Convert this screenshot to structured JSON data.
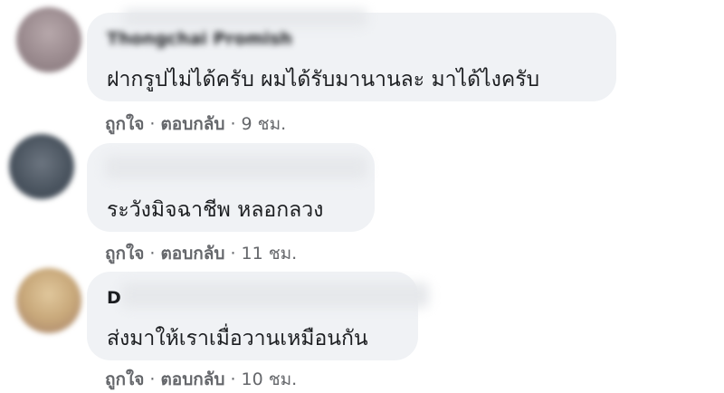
{
  "comments": [
    {
      "name": "Thongchai Promish",
      "text": "ฝากรูปไม่ได้ครับ ผมได้รับมานานละ มาได้ไงครับ",
      "like": "ถูกใจ",
      "reply": "ตอบกลับ",
      "time": "9 ชม.",
      "avatar_color": "#9a8a8e"
    },
    {
      "name": "",
      "text": "ระวังมิจฉาชีพ หลอกลวง",
      "like": "ถูกใจ",
      "reply": "ตอบกลับ",
      "time": "11 ชม.",
      "avatar_color": "#4b5560"
    },
    {
      "name": "D",
      "text": "ส่งมาให้เราเมื่อวานเหมือนกัน",
      "like": "ถูกใจ",
      "reply": "ตอบกลับ",
      "time": "10 ชม.",
      "avatar_color": "#c8a87a"
    }
  ],
  "separator": "·"
}
